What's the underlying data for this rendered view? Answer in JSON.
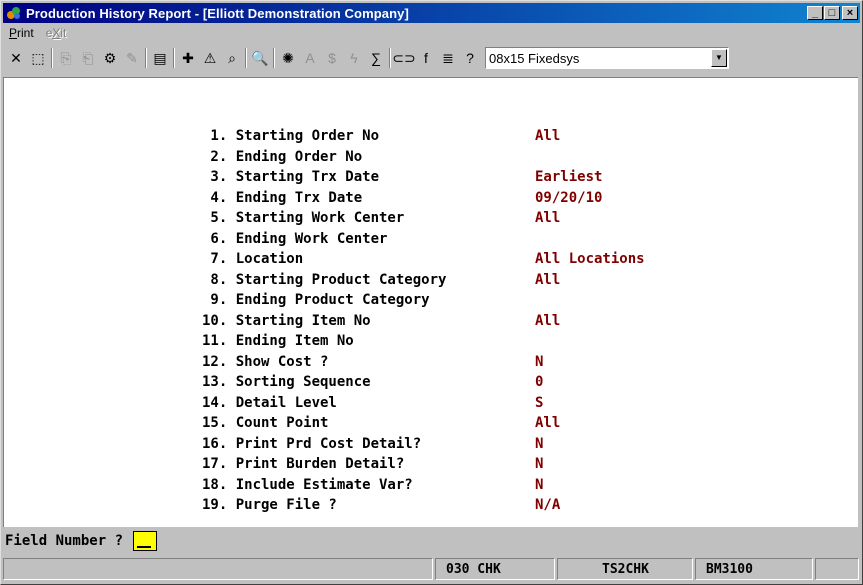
{
  "window": {
    "title": "Production History Report - [Elliott Demonstration Company]",
    "min": "_",
    "max": "□",
    "close": "×"
  },
  "menu": [
    {
      "pre": "",
      "ul": "P",
      "post": "rint",
      "disabled": false
    },
    {
      "pre": "e",
      "ul": "X",
      "post": "it",
      "disabled": true
    }
  ],
  "toolbar": {
    "icons": [
      "close-icon",
      "select-icon",
      "copy-icon",
      "paste-icon",
      "settings-icon",
      "properties-icon",
      "document-icon",
      "new-record-icon",
      "warning-icon",
      "binoculars-icon",
      "find-icon",
      "color-icon",
      "text-icon",
      "money-icon",
      "lightning-icon",
      "calc-icon",
      "link-icon",
      "function-icon",
      "list-icon",
      "help-pointer-icon"
    ],
    "glyphs": [
      "✕",
      "⬚",
      "⎘",
      "⎗",
      "⚙",
      "✎",
      "▤",
      "✚",
      "⚠",
      "⌕",
      "🔍",
      "✺",
      "A",
      "$",
      "ϟ",
      "∑",
      "⊂⊃",
      "f",
      "≣",
      "?"
    ],
    "font_select": "08x15 Fixedsys"
  },
  "fields": [
    {
      "label": "1. Starting Order No",
      "value": "All"
    },
    {
      "label": "2. Ending Order No",
      "value": ""
    },
    {
      "label": "3. Starting Trx Date",
      "value": "Earliest"
    },
    {
      "label": "4. Ending Trx Date",
      "value": "09/20/10"
    },
    {
      "label": "5. Starting Work Center",
      "value": "All"
    },
    {
      "label": "6. Ending Work Center",
      "value": ""
    },
    {
      "label": "7. Location",
      "value": "All Locations"
    },
    {
      "label": "8. Starting Product Category",
      "value": "All"
    },
    {
      "label": "9. Ending Product Category",
      "value": ""
    },
    {
      "label": "10. Starting Item No",
      "value": "All"
    },
    {
      "label": "11. Ending Item No",
      "value": ""
    },
    {
      "label": "12. Show Cost ?",
      "value": "N"
    },
    {
      "label": "13. Sorting Sequence",
      "value": "0"
    },
    {
      "label": "14. Detail Level",
      "value": "S"
    },
    {
      "label": "15. Count Point",
      "value": "All"
    },
    {
      "label": "16. Print Prd Cost Detail?",
      "value": "N"
    },
    {
      "label": "17. Print Burden Detail?",
      "value": "N"
    },
    {
      "label": "18. Include Estimate Var?",
      "value": "N"
    },
    {
      "label": "19. Purge File ?",
      "value": "N/A"
    }
  ],
  "prompt": {
    "text": "Field Number ?"
  },
  "status": {
    "p1": "",
    "p2": "030 CHK",
    "p3": "TS2CHK",
    "p4": "BM3100",
    "p5": ""
  }
}
